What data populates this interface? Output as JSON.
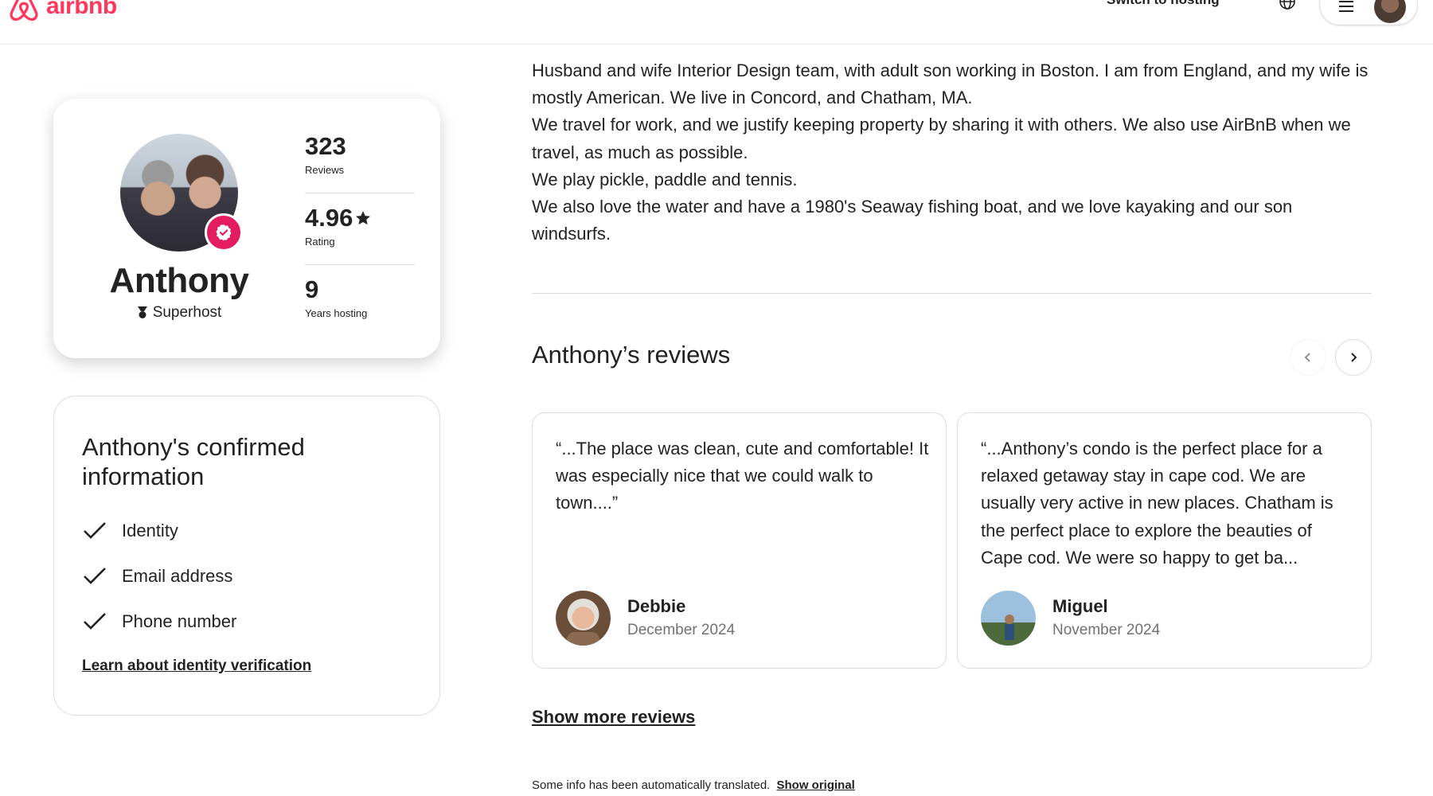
{
  "header": {
    "logo_text": "airbnb",
    "switch_label": "Switch to hosting",
    "globe_icon": "globe-icon",
    "menu_icon": "hamburger-icon"
  },
  "profile": {
    "name": "Anthony",
    "type": "Superhost",
    "stats": [
      {
        "value": "323",
        "label": "Reviews"
      },
      {
        "value": "4.96",
        "label": "Rating"
      },
      {
        "value": "9",
        "label": "Years hosting"
      }
    ]
  },
  "confirmed": {
    "title": "Anthony's confirmed information",
    "items": [
      "Identity",
      "Email address",
      "Phone number"
    ],
    "link": "Learn about identity verification"
  },
  "about": [
    "Husband and wife Interior Design team,  with adult son working in Boston. I am from England, and my wife is mostly American.  We live in Concord, and Chatham, MA.",
    "We travel for work, and we justify keeping property by sharing it with others.  We also use AirBnB when we travel, as much as possible.",
    "We play pickle, paddle and tennis.",
    "We also love the water and have a 1980's Seaway fishing boat, and we love kayaking and our son windsurfs."
  ],
  "reviews": {
    "title": "Anthony’s reviews",
    "items": [
      {
        "text": "“...The place was clean, cute and comfortable! It was especially nice that we could walk to town....”",
        "name": "Debbie",
        "date": "December 2024"
      },
      {
        "text": "“...Anthony’s condo is the perfect place for a relaxed getaway stay in cape cod. We are usually very active in new places. Chatham is the perfect place to explore the beauties of Cape cod. We were so happy to get ba...",
        "name": "Miguel",
        "date": "November 2024"
      }
    ],
    "show_more": "Show more reviews"
  },
  "footer": {
    "translated_note": "Some info has been automatically translated.",
    "show_original": "Show original"
  },
  "colors": {
    "brand": "#ff385c",
    "badge": "#e31c5f",
    "text": "#222222",
    "muted": "#717171",
    "border": "#dddddd"
  }
}
